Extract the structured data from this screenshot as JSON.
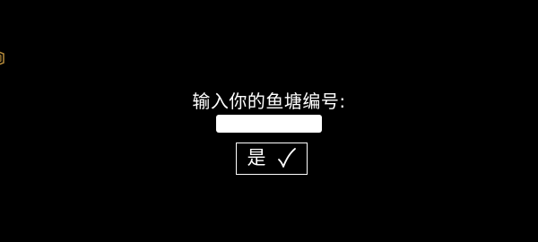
{
  "app": {
    "background_color": "#000000",
    "text_color": "#ffffff",
    "badge_color": "#b58a3a"
  },
  "dialog": {
    "prompt": "输入你的鱼塘编号:",
    "input_value": "",
    "confirm_label": "是",
    "confirm_icon": "checkmark-icon",
    "corner_icon": "hexagon-badge-icon"
  }
}
